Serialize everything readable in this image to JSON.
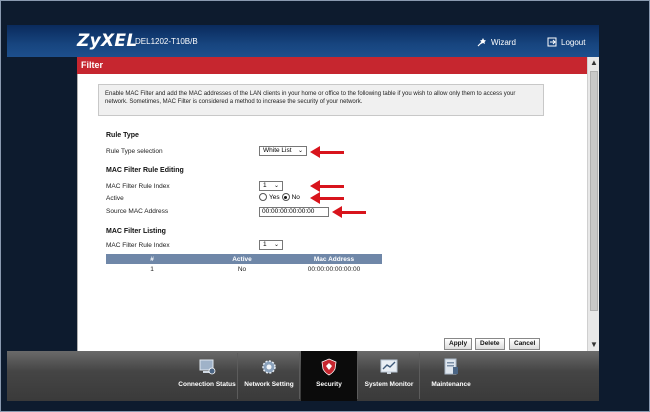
{
  "header": {
    "brand": "ZyXEL",
    "model": "DEL1202-T10B/B",
    "wizard_label": "Wizard",
    "logout_label": "Logout"
  },
  "page": {
    "title": "Filter"
  },
  "description": "Enable MAC Filter and add the MAC addresses of the LAN clients in your home or office to the following table if you wish to allow only them to access your network. Sometimes, MAC Filter is considered a method to increase the security of your network.",
  "rule_type": {
    "heading": "Rule Type",
    "selection_label": "Rule Type selection",
    "selection_value": "White List"
  },
  "rule_editing": {
    "heading": "MAC Filter Rule Editing",
    "index_label": "MAC Filter Rule Index",
    "index_value": "1",
    "active_label": "Active",
    "active_yes": "Yes",
    "active_no": "No",
    "active_selected": "No",
    "source_mac_label": "Source MAC Address",
    "source_mac_value": "00:00:00:00:00:00"
  },
  "listing": {
    "heading": "MAC Filter Listing",
    "index_label": "MAC Filter Rule Index",
    "index_value": "1",
    "columns": [
      "#",
      "Active",
      "Mac Address"
    ],
    "rows": [
      [
        "1",
        "No",
        "00:00:00:00:00:00"
      ]
    ]
  },
  "buttons": {
    "apply": "Apply",
    "delete": "Delete",
    "cancel": "Cancel"
  },
  "nav": [
    {
      "label": "Connection Status",
      "icon": "connection-status-icon"
    },
    {
      "label": "Network Setting",
      "icon": "network-setting-icon"
    },
    {
      "label": "Security",
      "icon": "security-shield-icon",
      "active": true
    },
    {
      "label": "System Monitor",
      "icon": "system-monitor-icon"
    },
    {
      "label": "Maintenance",
      "icon": "maintenance-icon"
    }
  ],
  "colors": {
    "header_blue": "#17457f",
    "title_red": "#c6262f",
    "arrow_red": "#d8141c",
    "table_header": "#6f87a8"
  }
}
